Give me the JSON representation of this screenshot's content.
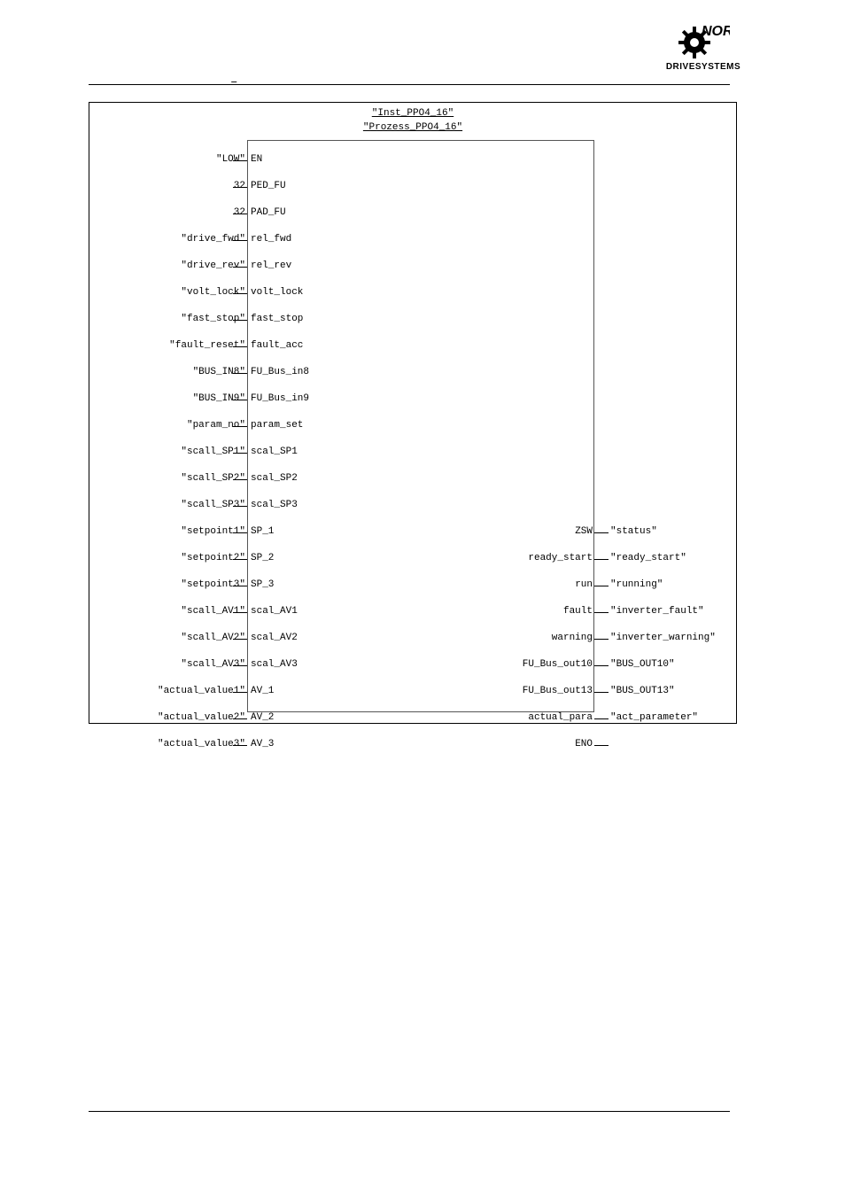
{
  "header": {
    "dash": "–"
  },
  "logo": {
    "line1": "NORD",
    "line2": "DRIVESYSTEMS"
  },
  "block": {
    "instance": "\"Inst_PPO4_16\"",
    "type": "\"Prozess_PPO4_16\""
  },
  "inputs": [
    {
      "ext": "\"LOW\"",
      "int": "EN"
    },
    {
      "ext": "32",
      "int": "PED_FU"
    },
    {
      "ext": "32",
      "int": "PAD_FU"
    },
    {
      "ext": "\"drive_fwd\"",
      "int": "rel_fwd"
    },
    {
      "ext": "\"drive_rev\"",
      "int": "rel_rev"
    },
    {
      "ext": "\"volt_lock\"",
      "int": "volt_lock"
    },
    {
      "ext": "\"fast_stop\"",
      "int": "fast_stop"
    },
    {
      "ext": "\"fault_reset\"",
      "int": "fault_acc"
    },
    {
      "ext": "\"BUS_IN8\"",
      "int": "FU_Bus_in8"
    },
    {
      "ext": "\"BUS_IN9\"",
      "int": "FU_Bus_in9"
    },
    {
      "ext": "\"param_no\"",
      "int": "param_set"
    },
    {
      "ext": "\"scall_SP1\"",
      "int": "scal_SP1"
    },
    {
      "ext": "\"scall_SP2\"",
      "int": "scal_SP2"
    },
    {
      "ext": "\"scall_SP3\"",
      "int": "scal_SP3"
    },
    {
      "ext": "\"setpoint1\"",
      "int": "SP_1"
    },
    {
      "ext": "\"setpoint2\"",
      "int": "SP_2"
    },
    {
      "ext": "\"setpoint3\"",
      "int": "SP_3"
    },
    {
      "ext": "\"scall_AV1\"",
      "int": "scal_AV1"
    },
    {
      "ext": "\"scall_AV2\"",
      "int": "scal_AV2"
    },
    {
      "ext": "\"scall_AV3\"",
      "int": "scal_AV3"
    },
    {
      "ext": "\"actual_value1\"",
      "int": "AV_1"
    },
    {
      "ext": "\"actual_value2\"",
      "int": "AV_2"
    },
    {
      "ext": "\"actual_value3\"",
      "int": "AV_3"
    }
  ],
  "outputs": [
    {
      "int": "ZSW",
      "ext": "\"status\""
    },
    {
      "int": "ready_start",
      "ext": "\"ready_start\""
    },
    {
      "int": "run",
      "ext": "\"running\""
    },
    {
      "int": "fault",
      "ext": "\"inverter_fault\""
    },
    {
      "int": "warning",
      "ext": "\"inverter_warning\""
    },
    {
      "int": "FU_Bus_out10",
      "ext": "\"BUS_OUT10\""
    },
    {
      "int": "FU_Bus_out13",
      "ext": "\"BUS_OUT13\""
    },
    {
      "int": "actual_para",
      "ext": "\"act_parameter\""
    },
    {
      "int": "ENO",
      "ext": ""
    }
  ]
}
